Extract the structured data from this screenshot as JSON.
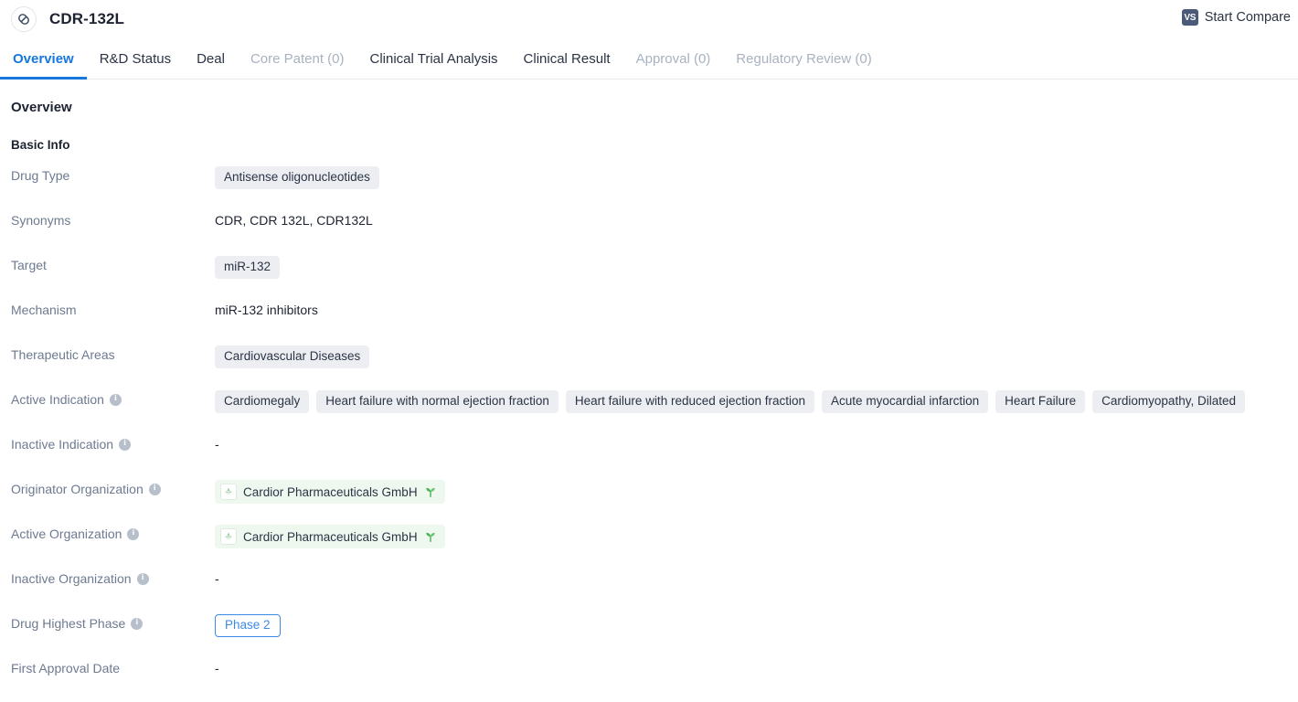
{
  "header": {
    "title": "CDR-132L",
    "drug_icon": "pill-capsule-icon",
    "compare": {
      "badge": "VS",
      "label": "Start Compare"
    }
  },
  "tabs": [
    {
      "label": "Overview",
      "state": "active"
    },
    {
      "label": "R&D Status",
      "state": "normal"
    },
    {
      "label": "Deal",
      "state": "normal"
    },
    {
      "label": "Core Patent (0)",
      "state": "disabled"
    },
    {
      "label": "Clinical Trial Analysis",
      "state": "normal"
    },
    {
      "label": "Clinical Result",
      "state": "normal"
    },
    {
      "label": "Approval (0)",
      "state": "disabled"
    },
    {
      "label": "Regulatory Review (0)",
      "state": "disabled"
    }
  ],
  "main": {
    "section_title": "Overview",
    "subsection_title": "Basic Info",
    "rows": {
      "drug_type": {
        "label": "Drug Type",
        "tags": [
          "Antisense oligonucleotides"
        ]
      },
      "synonyms": {
        "label": "Synonyms",
        "text": "CDR,  CDR 132L,  CDR132L"
      },
      "target": {
        "label": "Target",
        "tags": [
          "miR-132"
        ]
      },
      "mechanism": {
        "label": "Mechanism",
        "text": "miR-132 inhibitors"
      },
      "therapeutic_areas": {
        "label": "Therapeutic Areas",
        "tags": [
          "Cardiovascular Diseases"
        ]
      },
      "active_indication": {
        "label": "Active Indication",
        "has_info": true,
        "tags": [
          "Cardiomegaly",
          "Heart failure with normal ejection fraction",
          "Heart failure with reduced ejection fraction",
          "Acute myocardial infarction",
          "Heart Failure",
          "Cardiomyopathy, Dilated"
        ]
      },
      "inactive_indication": {
        "label": "Inactive Indication",
        "has_info": true,
        "text": "-"
      },
      "originator_organization": {
        "label": "Originator Organization",
        "has_info": true,
        "org": "Cardior Pharmaceuticals GmbH"
      },
      "active_organization": {
        "label": "Active Organization",
        "has_info": true,
        "org": "Cardior Pharmaceuticals GmbH"
      },
      "inactive_organization": {
        "label": "Inactive Organization",
        "has_info": true,
        "text": "-"
      },
      "drug_highest_phase": {
        "label": "Drug Highest Phase",
        "has_info": true,
        "badge": "Phase 2"
      },
      "first_approval_date": {
        "label": "First Approval Date",
        "text": "-"
      }
    }
  },
  "colors": {
    "accent_blue": "#1677e0",
    "tag_gray": "#eceef2",
    "org_green": "#eef8ef",
    "phase_border": "#3b8ae8",
    "label_gray": "#6d7a90",
    "vs_badge": "#4a5a78"
  },
  "icons": {
    "info": "i",
    "sprout": "sprout-icon"
  }
}
